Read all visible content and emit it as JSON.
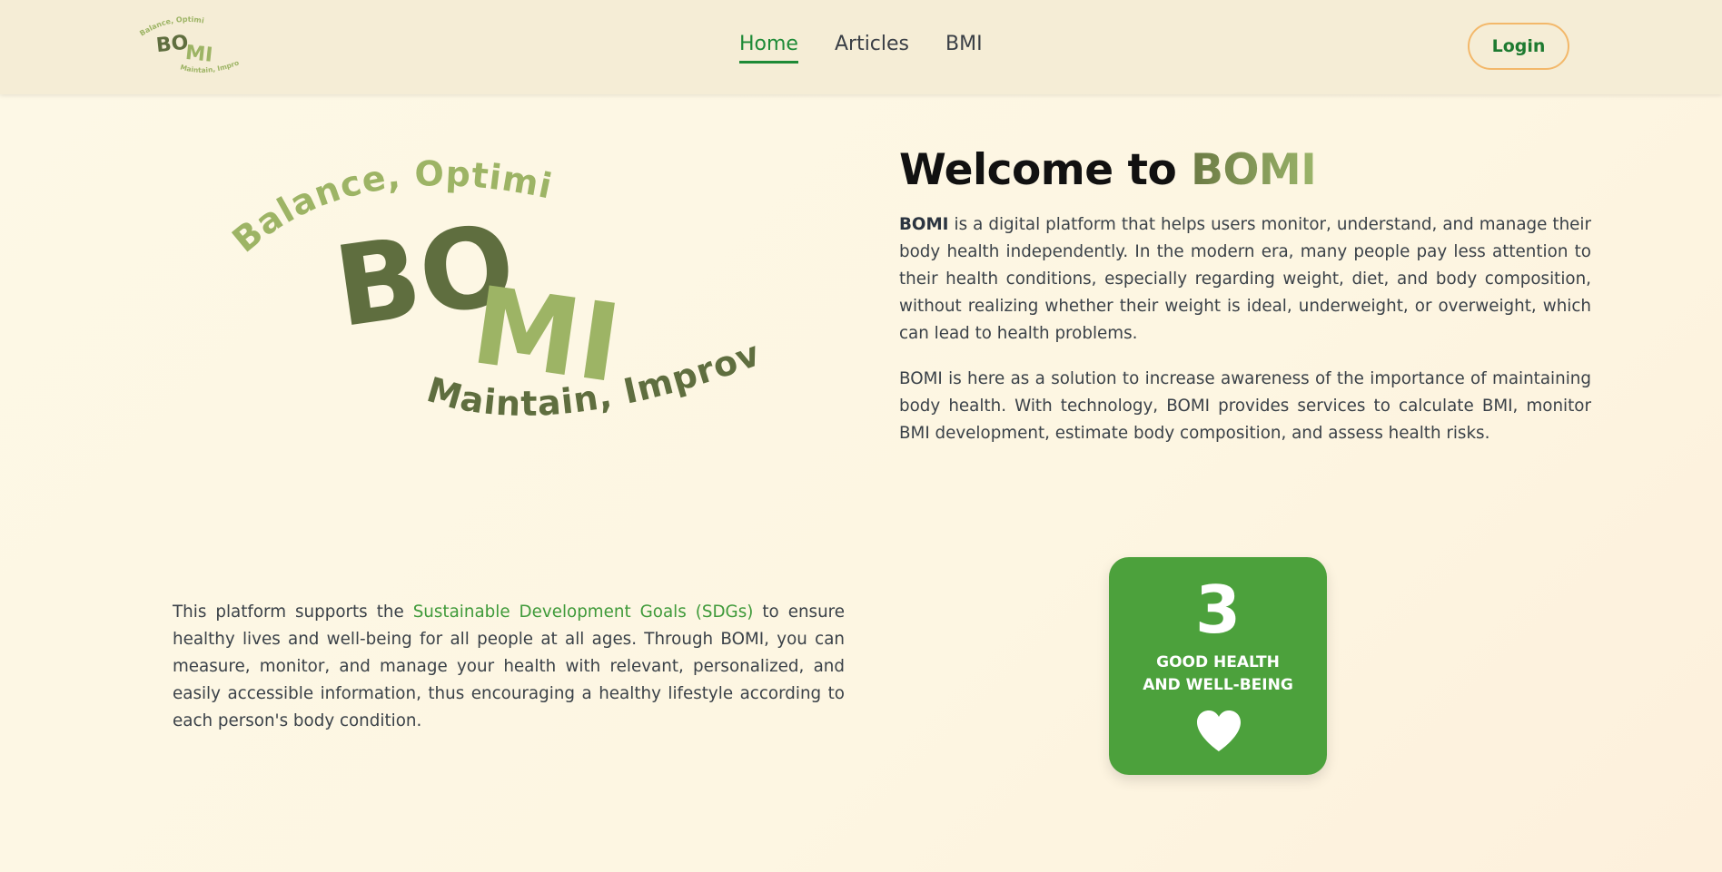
{
  "nav": {
    "logo": {
      "top_text": "Balance, Optimize",
      "letters_bo": "BO",
      "letters_mi": "MI",
      "bottom_text": "Maintain, Improve!"
    },
    "links": [
      {
        "label": "Home",
        "active": true
      },
      {
        "label": "Articles",
        "active": false
      },
      {
        "label": "BMI",
        "active": false
      }
    ],
    "login_label": "Login"
  },
  "hero": {
    "logo": {
      "top_text": "Balance, Optimize",
      "letters_bo": "BO",
      "letters_mi": "MI",
      "bottom_text": "Maintain, Improve!"
    },
    "title_prefix": "Welcome to ",
    "title_brand": "BOMI",
    "para1_bold": "BOMI",
    "para1_rest": " is a digital platform that helps users monitor, understand, and manage their body health independently. In the modern era, many people pay less attention to their health conditions, especially regarding weight, diet, and body composition, without realizing whether their weight is ideal, underweight, or overweight, which can lead to health problems.",
    "para2": "BOMI is here as a solution to increase awareness of the importance of maintaining body health. With technology, BOMI provides services to calculate BMI, monitor BMI development, estimate body composition, and assess health risks."
  },
  "sdg": {
    "text_before": "This platform supports the ",
    "link_text": "Sustainable Development Goals (SDGs)",
    "text_after": " to ensure healthy lives and well-being for all people at all ages. Through BOMI, you can measure, monitor, and manage your health with relevant, personalized, and easily accessible information, thus encouraging a healthy lifestyle according to each person's body condition.",
    "card": {
      "number": "3",
      "title_line1": "GOOD HEALTH",
      "title_line2": "AND WELL-BEING",
      "icon": "heart-icon",
      "color": "#4ca13c"
    }
  },
  "colors": {
    "accent_green": "#1d8a36",
    "logo_dark": "#5f6e3f",
    "logo_light": "#9db465",
    "login_border": "#f3b86a"
  }
}
